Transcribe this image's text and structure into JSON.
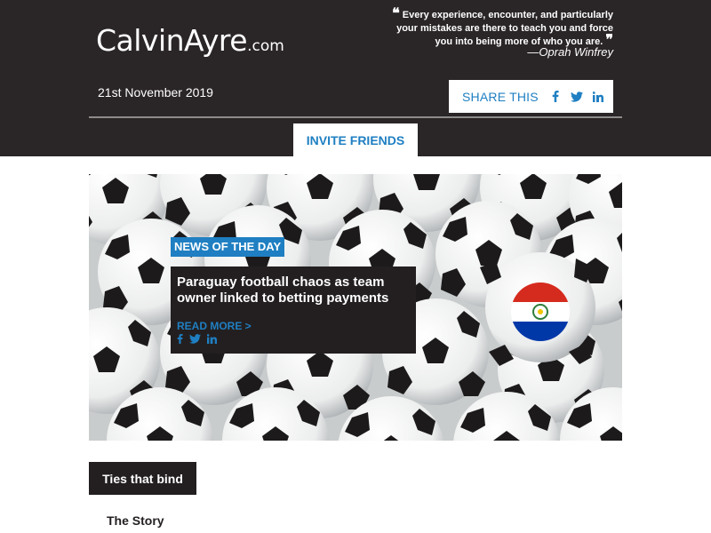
{
  "header": {
    "logo_main": "CalvinAyre",
    "logo_suffix": ".com",
    "quote_open": "❝",
    "quote_text": "Every experience, encounter, and particularly your mistakes are there to teach you and force you into being more of who you are.",
    "quote_close": "❞",
    "quote_author": "—Oprah Winfrey",
    "date": "21st November 2019",
    "share_label": "SHARE THIS",
    "share_icons": [
      "facebook-icon",
      "twitter-icon",
      "linkedin-icon"
    ],
    "invite_label": "INVITE FRIENDS"
  },
  "hero": {
    "badge": "NEWS OF THE DAY",
    "title": "Paraguay football chaos as team owner linked to betting payments",
    "read_more": "READ MORE >",
    "image_subject": "soccer balls with Paraguay flag ball"
  },
  "section": {
    "tab_label": "Ties that bind",
    "subheading": "The Story"
  },
  "colors": {
    "header_bg": "#2a2526",
    "accent_blue": "#1f7fc2",
    "dark_box": "#231f20",
    "paraguay_red": "#d52b1e",
    "paraguay_blue": "#0038a8"
  }
}
